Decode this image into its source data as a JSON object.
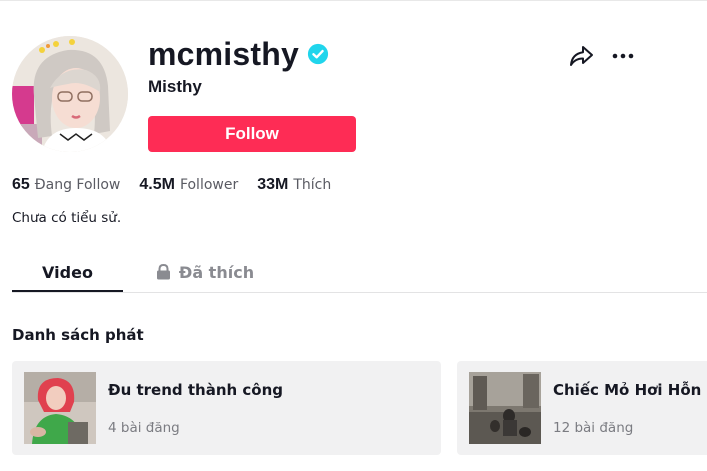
{
  "profile": {
    "username": "mcmisthy",
    "nickname": "Misthy",
    "verified": true,
    "follow_label": "Follow",
    "bio": "Chưa có tiểu sử."
  },
  "stats": [
    {
      "value": "65",
      "label": "Đang Follow"
    },
    {
      "value": "4.5M",
      "label": "Follower"
    },
    {
      "value": "33M",
      "label": "Thích"
    }
  ],
  "tabs": [
    {
      "label": "Video",
      "active": true
    },
    {
      "label": "Đã thích",
      "active": false,
      "icon": "lock-icon"
    }
  ],
  "playlists": {
    "title": "Danh sách phát",
    "items": [
      {
        "name": "Đu trend thành công",
        "count": "4 bài đăng"
      },
      {
        "name": "Chiếc Mỏ Hơi Hỗn",
        "count": "12 bài đăng"
      }
    ]
  },
  "icons": {
    "share": "share-icon",
    "more": "more-icon",
    "verified": "verified-badge-icon",
    "lock": "lock-icon"
  },
  "colors": {
    "accent": "#fe2c55",
    "verified": "#20d5ec",
    "text": "#161823",
    "muted": "#8a8b91",
    "card_bg": "#f1f1f2"
  }
}
